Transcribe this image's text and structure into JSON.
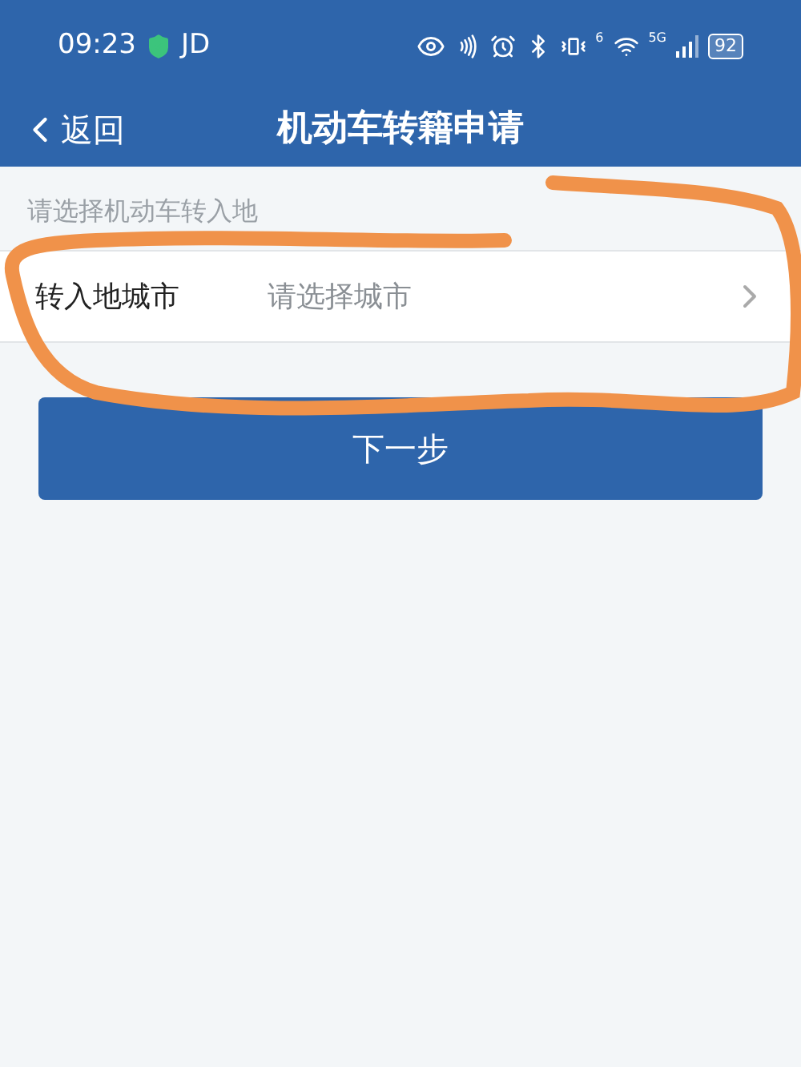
{
  "status_bar": {
    "time": "09:23",
    "carrier": "JD",
    "wifi_badge": "6",
    "network": "5G",
    "battery": "92"
  },
  "nav": {
    "back": "返回",
    "title": "机动车转籍申请"
  },
  "section_label": "请选择机动车转入地",
  "field": {
    "label": "转入地城市",
    "hint": "请选择城市"
  },
  "next_button": "下一步"
}
